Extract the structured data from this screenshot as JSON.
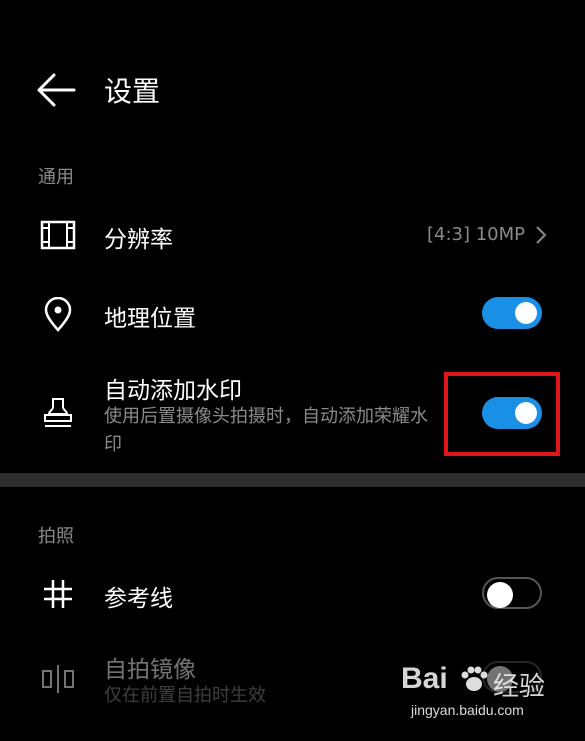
{
  "header": {
    "title": "设置"
  },
  "sections": {
    "general": "通用",
    "photo": "拍照"
  },
  "rows": {
    "resolution": {
      "label": "分辨率",
      "value": "[4:3] 10MP"
    },
    "location": {
      "label": "地理位置",
      "enabled": true
    },
    "watermark": {
      "label": "自动添加水印",
      "sub": "使用后置摄像头拍摄时，自动添加荣耀水印",
      "enabled": true
    },
    "gridlines": {
      "label": "参考线",
      "enabled": false
    },
    "mirror": {
      "label": "自拍镜像",
      "sub": "仅在前置自拍时生效",
      "enabled": false
    }
  },
  "watermark_brand": {
    "text": "Bai",
    "text2": "经验",
    "url": "jingyan.baidu.com"
  },
  "colors": {
    "accent": "#1a8fe6",
    "highlight": "#e0161d",
    "background": "#000000"
  }
}
